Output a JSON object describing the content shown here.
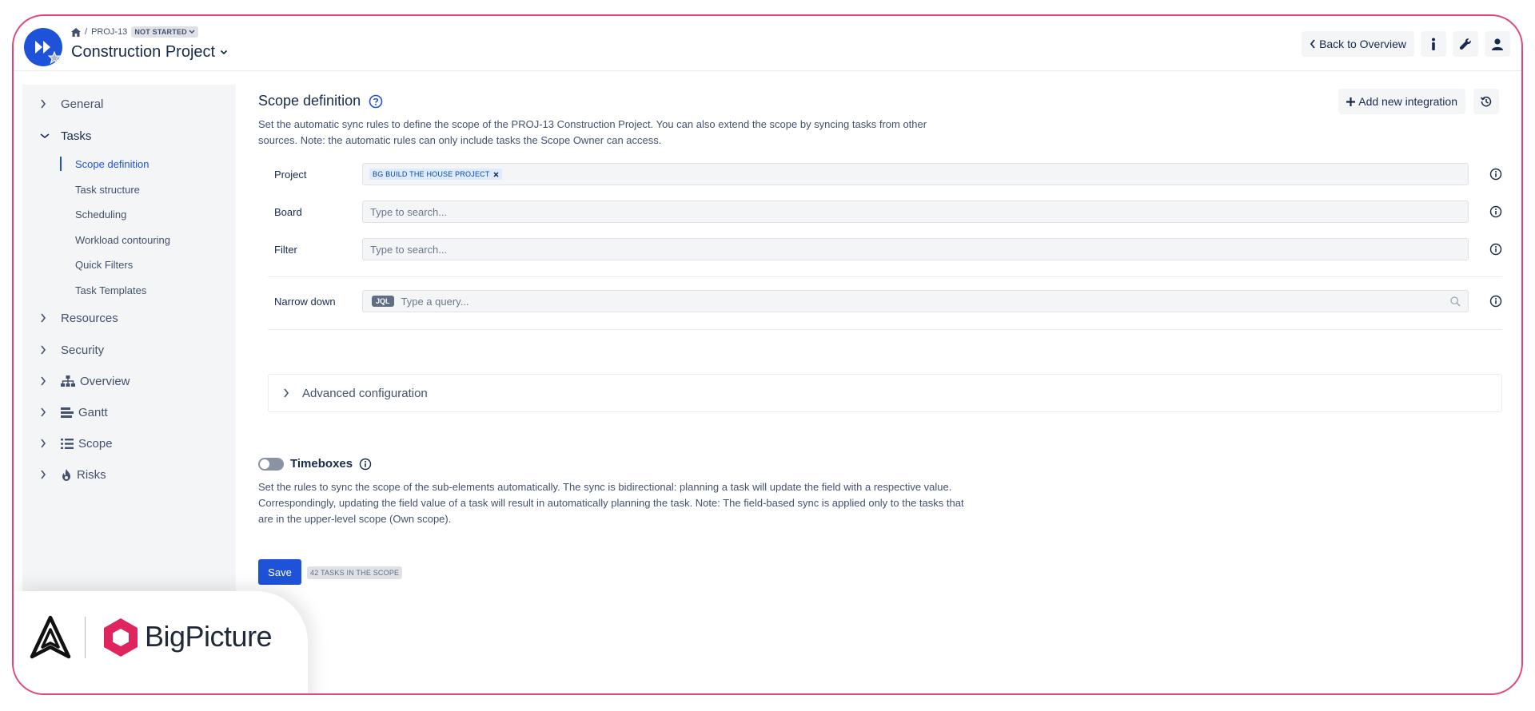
{
  "colors": {
    "accent": "#1e52d8",
    "frame_border": "#e0457b",
    "brand_red": "#e0245e",
    "sidebar_bg": "#f4f5f7"
  },
  "header": {
    "breadcrumb": {
      "home_icon": "home-icon",
      "separator": "/",
      "project_key": "PROJ-13",
      "status": "NOT STARTED"
    },
    "title": "Construction Project",
    "back_label": "Back to Overview",
    "icons": [
      "info-icon",
      "wrench-icon",
      "user-icon"
    ]
  },
  "sidebar": {
    "items": [
      {
        "label": "General",
        "expanded": false
      },
      {
        "label": "Tasks",
        "expanded": true,
        "children": [
          "Scope definition",
          "Task structure",
          "Scheduling",
          "Workload contouring",
          "Quick Filters",
          "Task Templates"
        ],
        "active_child": "Scope definition"
      },
      {
        "label": "Resources",
        "expanded": false
      },
      {
        "label": "Security",
        "expanded": false
      },
      {
        "label": "Overview",
        "expanded": false,
        "icon": "hierarchy-icon"
      },
      {
        "label": "Gantt",
        "expanded": false,
        "icon": "gantt-icon"
      },
      {
        "label": "Scope",
        "expanded": false,
        "icon": "list-icon"
      },
      {
        "label": "Risks",
        "expanded": false,
        "icon": "fire-icon"
      }
    ]
  },
  "main": {
    "title": "Scope definition",
    "description": "Set the automatic sync rules to define the scope of the PROJ-13 Construction Project. You can also extend the scope by syncing tasks from other sources. Note: the automatic rules can only include tasks the Scope Owner can access.",
    "add_integration_label": "Add new integration",
    "form": {
      "project": {
        "label": "Project",
        "tag": "BG BUILD THE HOUSE PROJECT"
      },
      "board": {
        "label": "Board",
        "placeholder": "Type to search..."
      },
      "filter": {
        "label": "Filter",
        "placeholder": "Type to search..."
      },
      "narrow_down": {
        "label": "Narrow down",
        "badge": "JQL",
        "placeholder": "Type a query..."
      }
    },
    "advanced_label": "Advanced configuration",
    "timeboxes": {
      "label": "Timeboxes",
      "enabled": false,
      "description": "Set the rules to sync the scope of the sub-elements automatically. The sync is bidirectional: planning a task will update the field with a respective value. Correspondingly, updating the field value of a task will result in automatically planning the task. Note: The field-based sync is applied only to the tasks that are in the upper-level scope (Own scope)."
    },
    "save_label": "Save",
    "scope_count": "42 TASKS IN THE SCOPE"
  },
  "brand": {
    "name": "BigPicture"
  }
}
